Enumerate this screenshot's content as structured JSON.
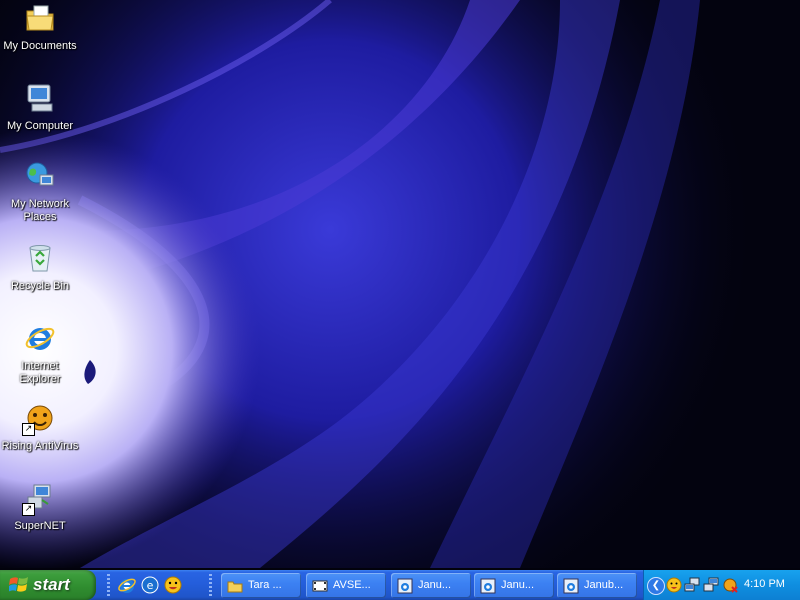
{
  "desktop": {
    "icons": [
      {
        "label": "My Documents",
        "icon": "folder-documents-icon"
      },
      {
        "label": "My Computer",
        "icon": "computer-icon"
      },
      {
        "label": "My Network Places",
        "icon": "network-places-icon"
      },
      {
        "label": "Recycle Bin",
        "icon": "recycle-bin-icon"
      },
      {
        "label": "Internet Explorer",
        "icon": "internet-explorer-icon"
      },
      {
        "label": "Rising AntiVirus",
        "icon": "rising-antivirus-icon"
      },
      {
        "label": "SuperNET",
        "icon": "supernet-icon"
      }
    ]
  },
  "taskbar": {
    "start_label": "start",
    "quick_launch": [
      "internet-explorer-icon",
      "outlook-express-icon",
      "messenger-icon"
    ],
    "tasks": [
      {
        "label": "Tara ...",
        "icon": "folder-icon"
      },
      {
        "label": "AVSE...",
        "icon": "video-editor-icon"
      },
      {
        "label": "Janu...",
        "icon": "internet-explorer-icon"
      },
      {
        "label": "Janu...",
        "icon": "internet-explorer-icon"
      },
      {
        "label": "Janub...",
        "icon": "internet-explorer-icon"
      }
    ],
    "tray": {
      "icons": [
        "messenger-icon",
        "network-icon",
        "network-icon",
        "rising-antivirus-icon"
      ],
      "time": "4:10 PM"
    }
  },
  "colors": {
    "taskbar": "#245edb",
    "start_button": "#3c9d3c",
    "tray": "#0f8ee0"
  }
}
